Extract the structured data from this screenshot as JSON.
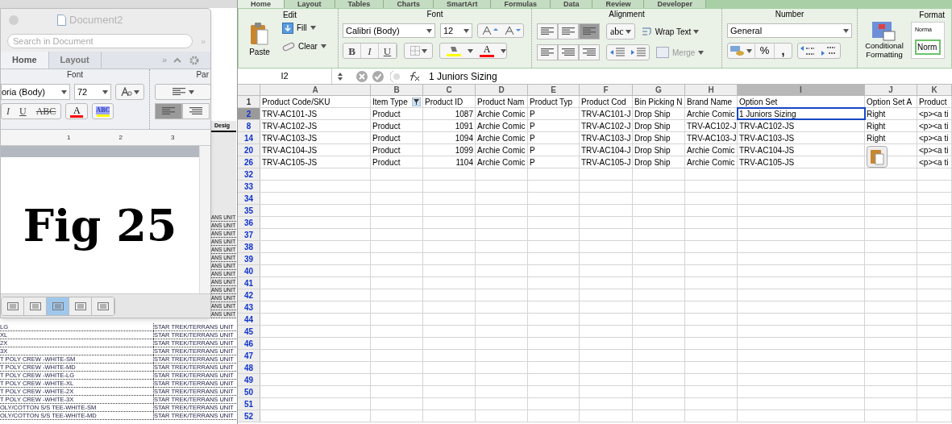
{
  "background_sheet": {
    "header_fragment": "Desig",
    "covered_rows": [
      "ANS UNIT",
      "ANS UNIT",
      "ANS UNIT",
      "ANS UNIT",
      "ANS UNIT",
      "ANS UNIT",
      "ANS UNIT",
      "ANS UNIT",
      "ANS UNIT",
      "ANS UNIT",
      "ANS UNIT",
      "ANS UNIT",
      "ANS UNIT"
    ],
    "rows": [
      {
        "col1": "LG",
        "col2": "STAR TREK/TERRANS UNIT"
      },
      {
        "col1": "XL",
        "col2": "STAR TREK/TERRANS UNIT"
      },
      {
        "col1": "2X",
        "col2": "STAR TREK/TERRANS UNIT"
      },
      {
        "col1": "3X",
        "col2": "STAR TREK/TERRANS UNIT"
      },
      {
        "col1": "T POLY CREW -WHITE-SM",
        "col2": "STAR TREK/TERRANS UNIT"
      },
      {
        "col1": "T POLY CREW -WHITE-MD",
        "col2": "STAR TREK/TERRANS UNIT"
      },
      {
        "col1": "T POLY CREW -WHITE-LG",
        "col2": "STAR TREK/TERRANS UNIT"
      },
      {
        "col1": "T POLY CREW -WHITE-XL",
        "col2": "STAR TREK/TERRANS UNIT"
      },
      {
        "col1": "T POLY CREW -WHITE-2X",
        "col2": "STAR TREK/TERRANS UNIT"
      },
      {
        "col1": "T POLY CREW -WHITE-3X",
        "col2": "STAR TREK/TERRANS UNIT"
      },
      {
        "col1": "OLY/COTTON S/S TEE-WHITE-SM",
        "col2": "STAR TREK/TERRANS UNIT"
      },
      {
        "col1": "OLY/COTTON S/S TEE-WHITE-MD",
        "col2": "STAR TREK/TERRANS UNIT"
      }
    ]
  },
  "word_window": {
    "title": "Document2",
    "search": {
      "placeholder": "Search in Document"
    },
    "more_label": "»",
    "tabs_more_label": "»",
    "tabs": [
      {
        "label": "Home",
        "selected": true
      },
      {
        "label": "Layout",
        "selected": false
      }
    ],
    "font_group": "Font",
    "paragraph_group": "Par",
    "font_name": "oria (Body)",
    "font_size": "72",
    "style_buttons": [
      "I",
      "U",
      "ABC"
    ],
    "font_color_label": "A",
    "highlight_label": "ABC",
    "align_buttons": [
      {
        "selected": true
      },
      {
        "selected": false
      }
    ],
    "ruler_marks": [
      "1",
      "2",
      "3"
    ],
    "document_text": "Fig 25",
    "view_buttons": [
      {
        "selected": false
      },
      {
        "selected": false
      },
      {
        "selected": true
      },
      {
        "selected": false
      },
      {
        "selected": false
      }
    ]
  },
  "excel": {
    "tabs": [
      {
        "label": "Home",
        "selected": true
      },
      {
        "label": "Layout",
        "selected": false
      },
      {
        "label": "Tables",
        "selected": false
      },
      {
        "label": "Charts",
        "selected": false
      },
      {
        "label": "SmartArt",
        "selected": false
      },
      {
        "label": "Formulas",
        "selected": false
      },
      {
        "label": "Data",
        "selected": false
      },
      {
        "label": "Review",
        "selected": false
      },
      {
        "label": "Developer",
        "selected": false
      }
    ],
    "groups": {
      "edit": "Edit",
      "font": "Font",
      "alignment": "Alignment",
      "number": "Number",
      "format": "Format"
    },
    "paste_label": "Paste",
    "fill_label": "Fill",
    "clear_label": "Clear",
    "font_name": "Calibri (Body)",
    "font_size": "12",
    "style_buttons": [
      "B",
      "I",
      "U"
    ],
    "font_color_label": "A",
    "align_buttons": [
      {
        "selected": false
      },
      {
        "selected": false
      },
      {
        "selected": true
      },
      {
        "selected": false
      },
      {
        "selected": false
      },
      {
        "selected": false
      }
    ],
    "orientation_label": "abc",
    "wrap_text_label": "Wrap Text",
    "merge": {
      "label": "Merge",
      "disabled": true
    },
    "number_format": "General",
    "percent_label": "%",
    "comma_label": ",",
    "conditional_formatting_label": "Conditional Formatting",
    "styles": [
      "Norma",
      "Norm"
    ],
    "name_box": "I2",
    "formula": "1 Juniors Sizing",
    "columns": [
      {
        "label": "A",
        "selected": false,
        "numeric": false,
        "filtered": false
      },
      {
        "label": "B",
        "selected": false,
        "numeric": false,
        "filtered": true
      },
      {
        "label": "C",
        "selected": false,
        "numeric": true,
        "filtered": false
      },
      {
        "label": "D",
        "selected": false,
        "numeric": false,
        "filtered": false
      },
      {
        "label": "E",
        "selected": false,
        "numeric": false,
        "filtered": false
      },
      {
        "label": "F",
        "selected": false,
        "numeric": false,
        "filtered": false
      },
      {
        "label": "G",
        "selected": false,
        "numeric": false,
        "filtered": false
      },
      {
        "label": "H",
        "selected": false,
        "numeric": false,
        "filtered": false
      },
      {
        "label": "I",
        "selected": true,
        "numeric": false,
        "filtered": false
      },
      {
        "label": "J",
        "selected": false,
        "numeric": false,
        "filtered": false
      },
      {
        "label": "K",
        "selected": false,
        "numeric": false,
        "filtered": false
      }
    ],
    "header_row": {
      "number": "1",
      "cells": [
        "Product Code/SKU",
        "Item Type",
        "Product ID",
        "Product Nam",
        "Product Typ",
        "Product Cod",
        "Bin Picking N",
        "Brand Name",
        "Option Set",
        "Option Set A",
        "Product"
      ]
    },
    "rows": [
      {
        "number": "2",
        "selected": true,
        "cursor": true,
        "cells": [
          "TRV-AC101-JS",
          "Product",
          "1087",
          "Archie Comic",
          "P",
          "TRV-AC101-J",
          "Drop Ship",
          "Archie Comic",
          "1 Juniors Sizing",
          "Right",
          "<p><a ti"
        ]
      },
      {
        "number": "8",
        "selected": false,
        "cursor": false,
        "cells": [
          "TRV-AC102-JS",
          "Product",
          "1091",
          "Archie Comic",
          "P",
          "TRV-AC102-J",
          "Drop Ship",
          "TRV-AC102-J",
          "TRV-AC102-JS",
          "Right",
          "<p><a ti"
        ]
      },
      {
        "number": "14",
        "selected": false,
        "cursor": false,
        "cells": [
          "TRV-AC103-JS",
          "Product",
          "1094",
          "Archie Comic",
          "P",
          "TRV-AC103-J",
          "Drop Ship",
          "TRV-AC103-J",
          "TRV-AC103-JS",
          "Right",
          "<p><a ti"
        ]
      },
      {
        "number": "20",
        "selected": false,
        "cursor": false,
        "cells": [
          "TRV-AC104-JS",
          "Product",
          "1099",
          "Archie Comic",
          "P",
          "TRV-AC104-J",
          "Drop Ship",
          "Archie Comic",
          "TRV-AC104-JS",
          "",
          "<p><a ti"
        ]
      },
      {
        "number": "26",
        "selected": false,
        "cursor": false,
        "cells": [
          "TRV-AC105-JS",
          "Product",
          "1104",
          "Archie Comic",
          "P",
          "TRV-AC105-J",
          "Drop Ship",
          "Archie Comic",
          "TRV-AC105-JS",
          "",
          "<p><a ti"
        ]
      }
    ],
    "empty_rows": [
      "32",
      "33",
      "34",
      "35",
      "36",
      "37",
      "38",
      "39",
      "40",
      "41",
      "42",
      "43",
      "44",
      "45",
      "46",
      "47",
      "48",
      "49",
      "50",
      "51",
      "52"
    ]
  }
}
